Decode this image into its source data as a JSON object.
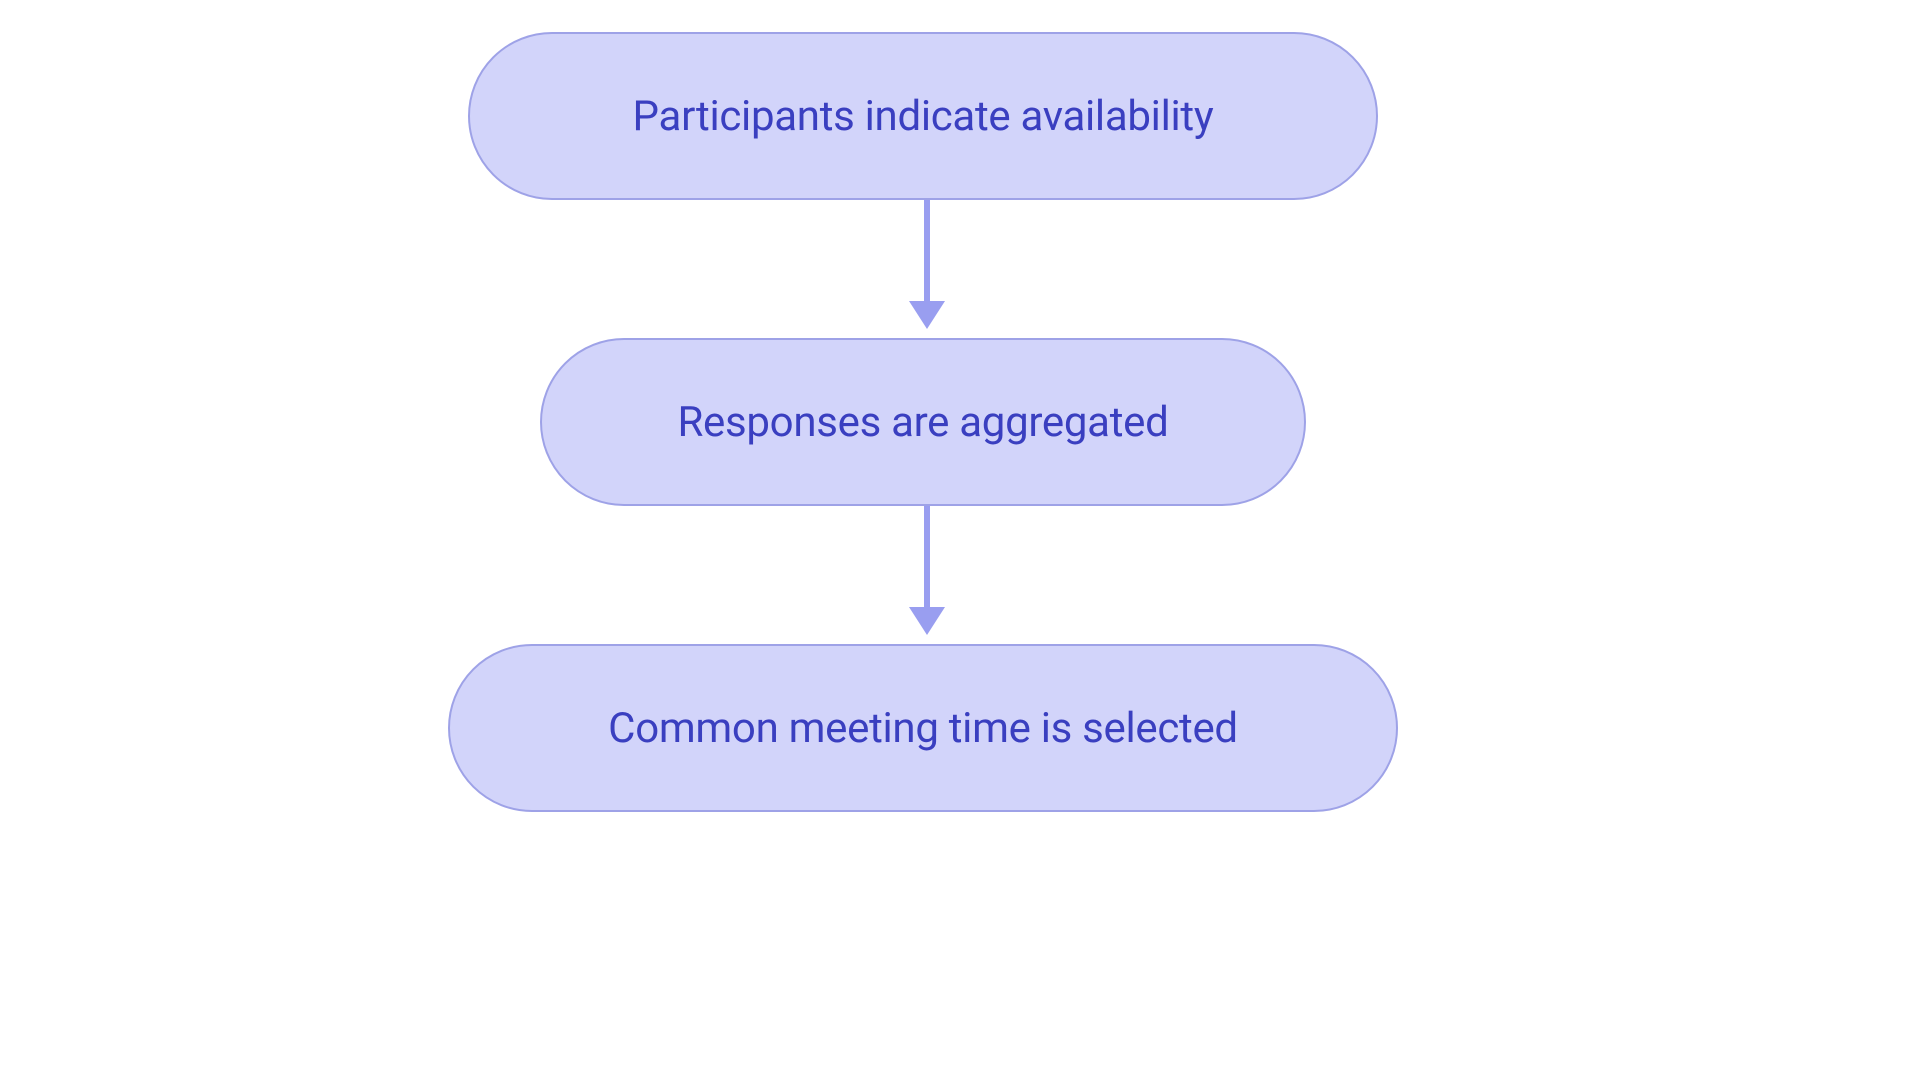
{
  "chart_data": {
    "type": "flowchart",
    "direction": "top-to-bottom",
    "nodes": [
      {
        "id": "n1",
        "label": "Participants indicate availability"
      },
      {
        "id": "n2",
        "label": "Responses are aggregated"
      },
      {
        "id": "n3",
        "label": "Common meeting time is selected"
      }
    ],
    "edges": [
      {
        "from": "n1",
        "to": "n2"
      },
      {
        "from": "n2",
        "to": "n3"
      }
    ],
    "colors": {
      "node_fill": "#d2d4fa",
      "node_border": "#9ea2e7",
      "text": "#3a3fc0",
      "arrow": "#999ef0"
    }
  }
}
